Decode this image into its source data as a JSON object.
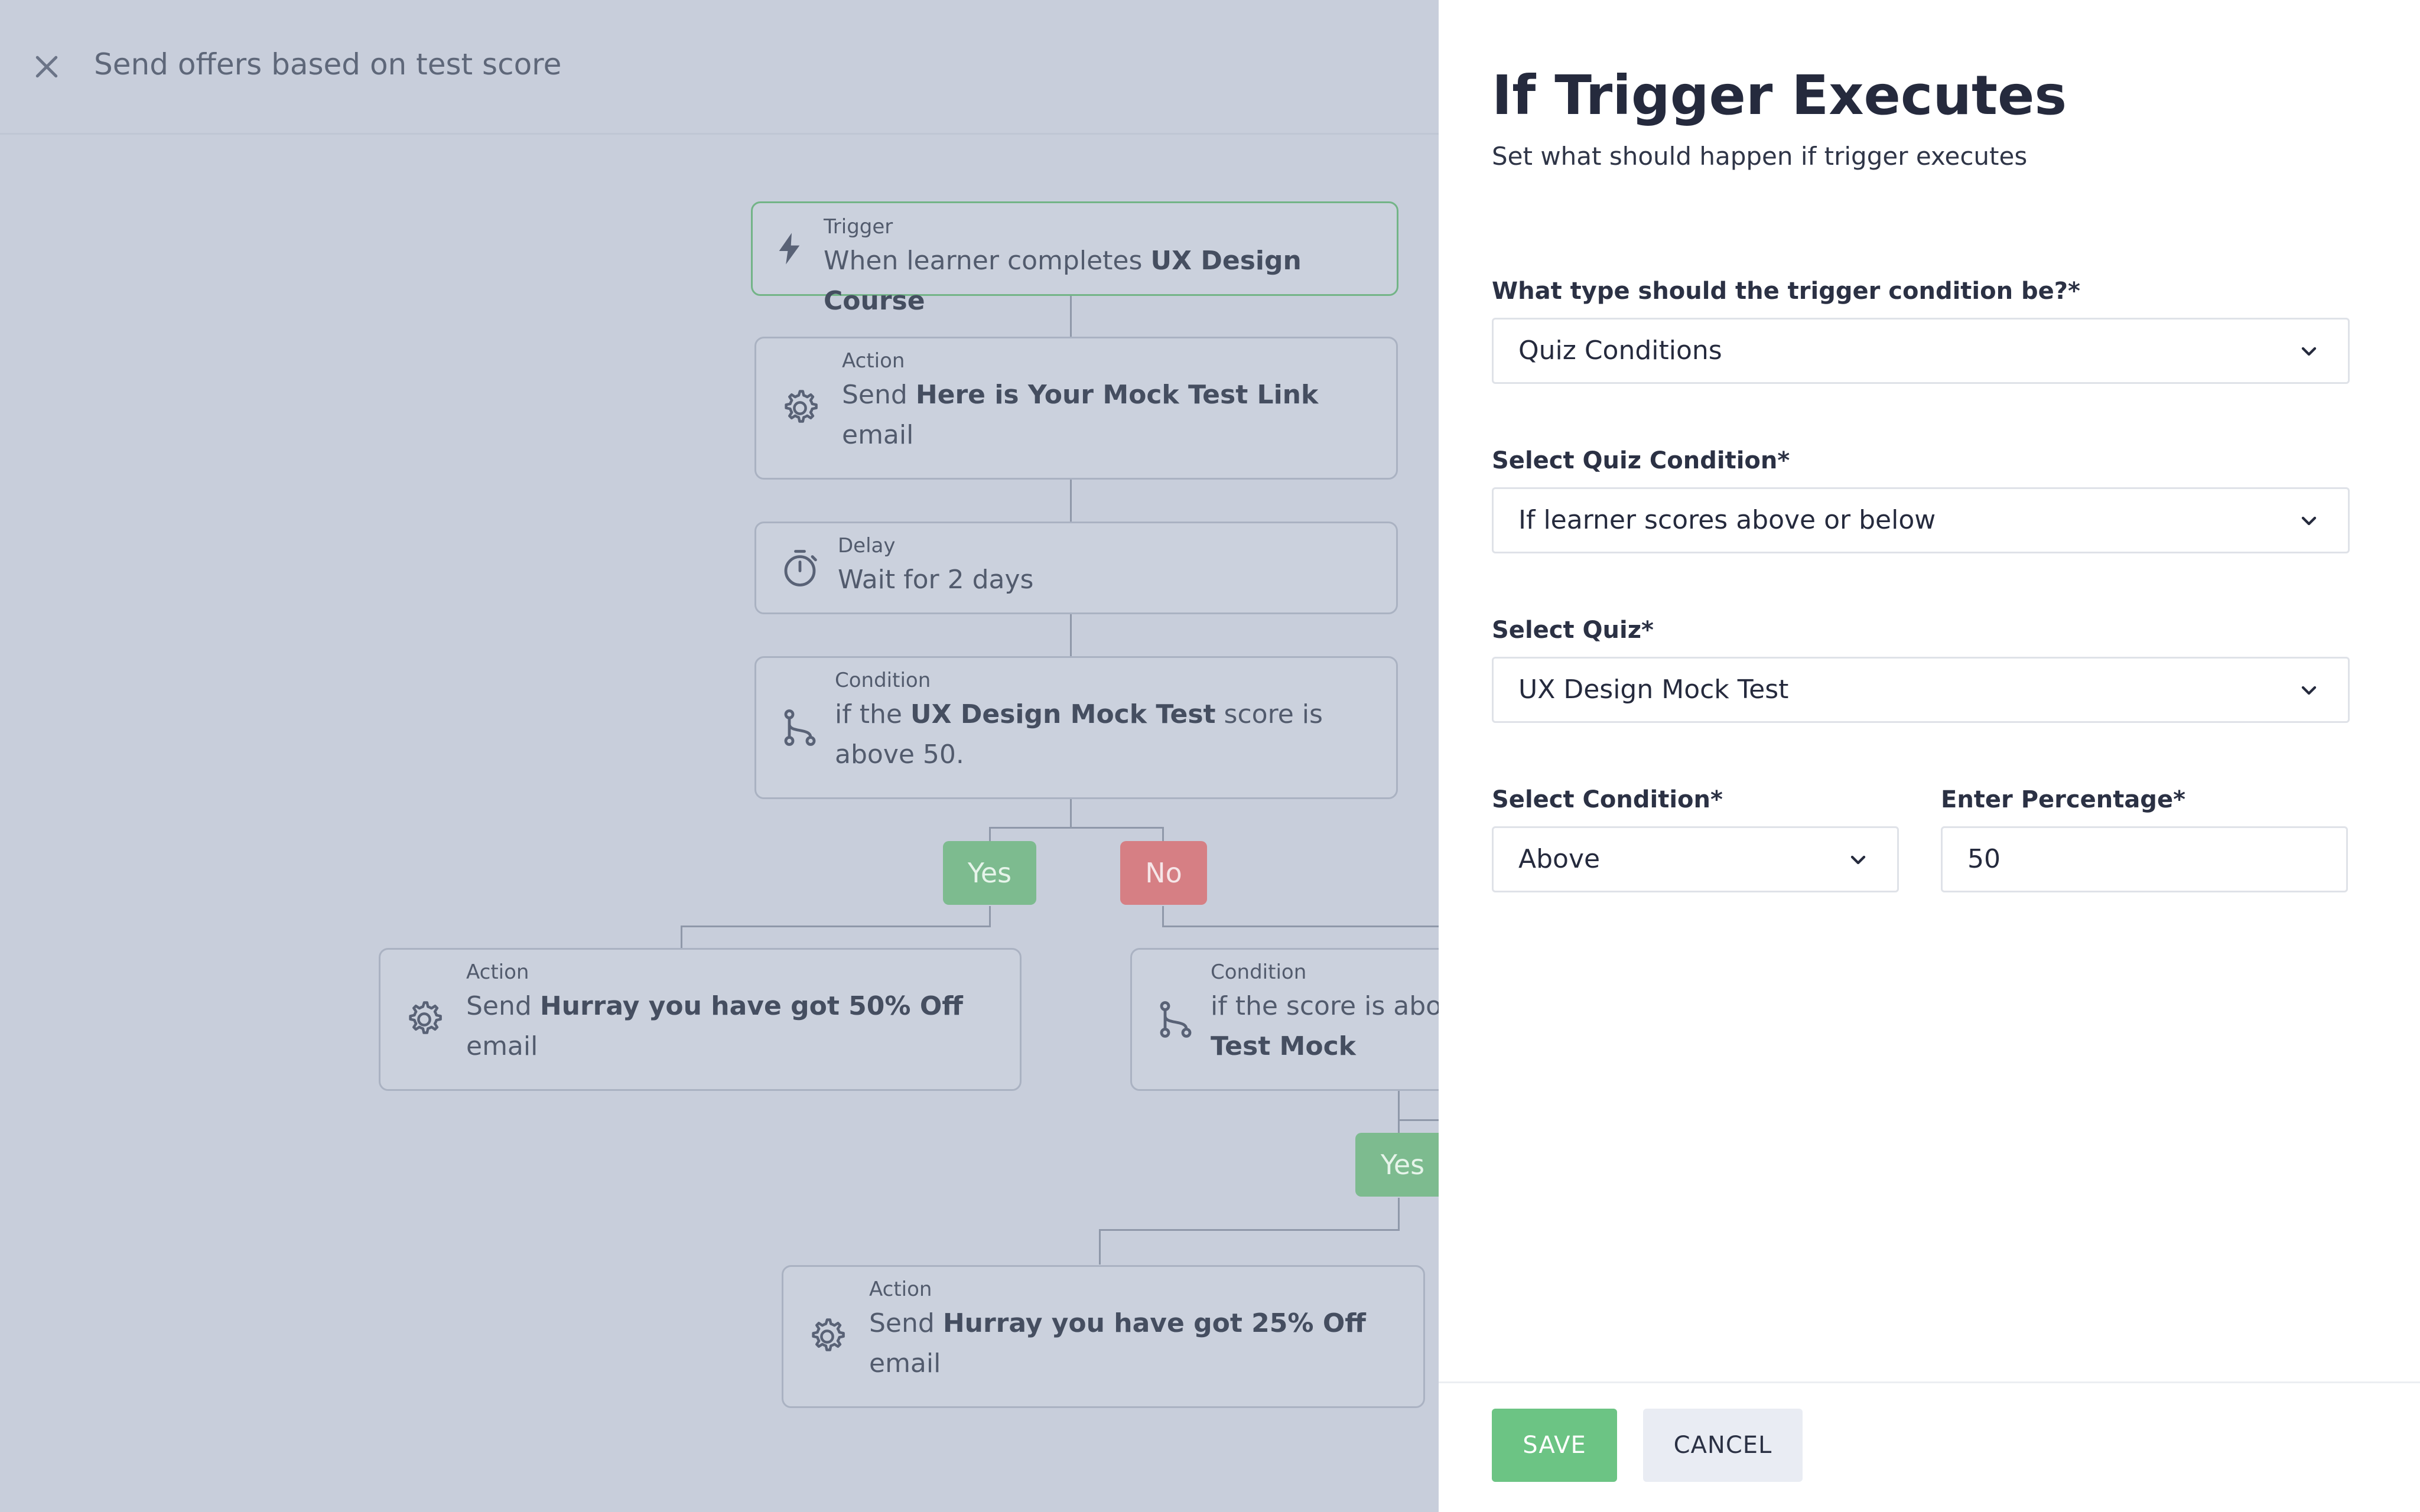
{
  "header": {
    "title": "Send offers based on test score"
  },
  "flow": {
    "trigger": {
      "kind": "Trigger",
      "text_pre": "When learner completes ",
      "text_bold": "UX Design Course"
    },
    "action1": {
      "kind": "Action",
      "text_pre": "Send ",
      "text_bold": "Here is Your Mock Test Link",
      "text_post": "email"
    },
    "delay": {
      "kind": "Delay",
      "text": "Wait for 2 days"
    },
    "condition1": {
      "kind": "Condition",
      "text_pre": "if the ",
      "text_bold": "UX Design Mock Test",
      "text_post": " score is above 50."
    },
    "yes_label": "Yes",
    "no_label": "No",
    "action2": {
      "kind": "Action",
      "text_pre": "Send ",
      "text_bold": "Hurray you have got 50% Off",
      "text_post": "email"
    },
    "condition2": {
      "kind": "Condition",
      "text_pre": "if the score is abov",
      "text_bold": "Test Mock"
    },
    "yes2_label": "Yes",
    "action3": {
      "kind": "Action",
      "text_pre": "Send ",
      "text_bold": "Hurray you have got 25% Off",
      "text_post": "email"
    }
  },
  "panel": {
    "title": "If Trigger Executes",
    "subtitle": "Set what should happen if trigger executes",
    "fields": {
      "trigger_type": {
        "label": "What type should the trigger condition be?*",
        "value": "Quiz Conditions"
      },
      "quiz_condition": {
        "label": "Select Quiz Condition*",
        "value": "If learner scores above or below"
      },
      "quiz": {
        "label": "Select Quiz*",
        "value": "UX Design Mock Test"
      },
      "condition": {
        "label": "Select Condition*",
        "value": "Above"
      },
      "percentage": {
        "label": "Enter Percentage*",
        "value": "50"
      }
    },
    "save_label": "SAVE",
    "cancel_label": "CANCEL"
  },
  "colors": {
    "overlay": "#c8cedb",
    "save": "#6cc484",
    "yes": "#7dbb8f",
    "no": "#d67f84",
    "trigger_border": "#73b487"
  },
  "icons": {
    "close": "close-icon",
    "trigger": "lightning-icon",
    "action": "gear-icon",
    "delay": "stopwatch-icon",
    "condition": "branch-icon",
    "dropdown": "chevron-down-icon"
  }
}
